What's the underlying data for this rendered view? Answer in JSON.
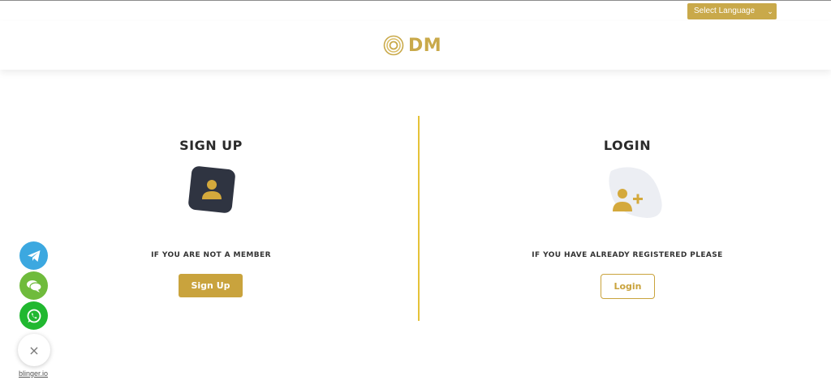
{
  "language_selector": {
    "selected": "Select Language",
    "chevron_icon": "chevron-down-icon"
  },
  "header": {
    "logo_text": "DM",
    "logo_icon": "target-circles-icon"
  },
  "signup": {
    "title": "SIGN UP",
    "subtitle": "IF YOU ARE NOT A MEMBER",
    "button_label": "Sign Up",
    "icon": "user-icon"
  },
  "login": {
    "title": "LOGIN",
    "subtitle": "IF YOU HAVE ALREADY REGISTERED PLEASE",
    "button_label": "Login",
    "icon": "user-plus-icon"
  },
  "chat_widget": {
    "buttons": [
      "telegram-icon",
      "chat-bubble-icon",
      "whatsapp-icon"
    ],
    "close_label": "×",
    "brand": "blinger.io"
  },
  "colors": {
    "gold": "#c9a94a",
    "divider": "#e5c238",
    "telegram": "#3ca8e0",
    "chat": "#6fbb3c",
    "whatsapp": "#21b830",
    "dark_tile": "#2f3441"
  }
}
